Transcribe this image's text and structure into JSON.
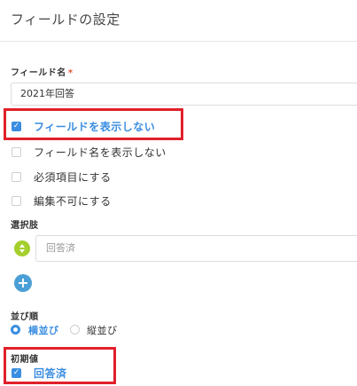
{
  "header": {
    "title": "フィールドの設定"
  },
  "field_name": {
    "label": "フィールド名",
    "required_mark": "*",
    "value": "2021年回答"
  },
  "options": [
    {
      "label": "フィールドを表示しない",
      "checked": true
    },
    {
      "label": "フィールド名を表示しない",
      "checked": false
    },
    {
      "label": "必須項目にする",
      "checked": false
    },
    {
      "label": "編集不可にする",
      "checked": false
    }
  ],
  "choices": {
    "label": "選択肢",
    "items": [
      {
        "placeholder": "回答済"
      }
    ],
    "add_icon": "plus-icon",
    "sort_icon": "sort-arrows-icon"
  },
  "order": {
    "label": "並び順",
    "options": [
      {
        "label": "横並び",
        "selected": true
      },
      {
        "label": "縦並び",
        "selected": false
      }
    ]
  },
  "initial_value": {
    "label": "初期値",
    "items": [
      {
        "label": "回答済",
        "checked": true
      }
    ]
  },
  "colors": {
    "accent": "#3a8de0",
    "highlight": "#e0202a",
    "required": "#e8542f",
    "sort_handle": "#a5cf2c",
    "add_button": "#4a9fd6"
  }
}
